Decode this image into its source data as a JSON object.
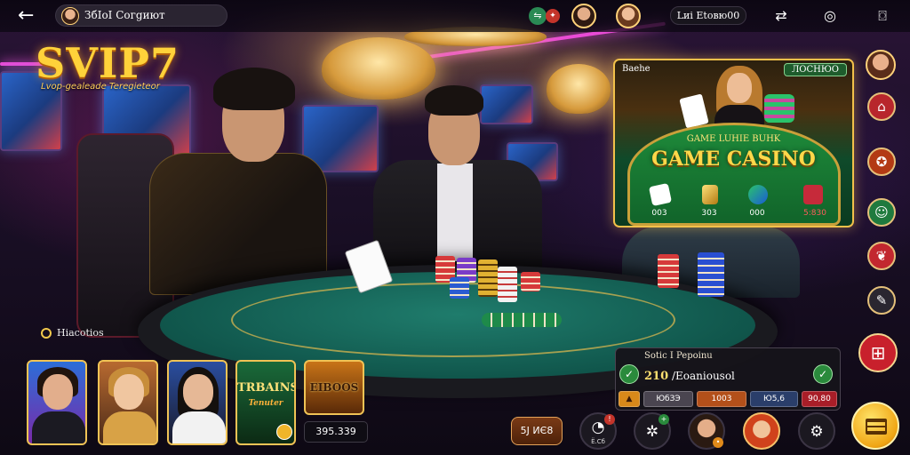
{
  "topbar": {
    "back_glyph": "←",
    "profile_name": "ЗбIоI Согgиют",
    "balance": "Lиі Еtовю00",
    "badge_green_glyph": "⇋",
    "badge_red_glyph": "✦",
    "icons": [
      "swap-icon",
      "target-icon",
      "camera-icon"
    ]
  },
  "logo": {
    "title": "SVIP7",
    "subtitle": "Lvop-gealeade Teregieteor"
  },
  "game_card": {
    "header_left": "Baehe",
    "header_right": "ЛОСНЮО",
    "subtitle": "GAME LUHIE BUHK",
    "title": "GAME CASINO",
    "stats": [
      "003",
      "303",
      "000",
      "5:830"
    ]
  },
  "left_label": "Hiacotios",
  "thumbs": [
    {
      "name": "player-1",
      "text": ""
    },
    {
      "name": "player-2",
      "text": ""
    },
    {
      "name": "player-3",
      "text": ""
    },
    {
      "name": "trebans",
      "text": "TRBAINS",
      "sub": "Tenuter"
    },
    {
      "name": "bingo",
      "text": "EIBOOS"
    }
  ],
  "thumb_amount": "395.339",
  "bottom": {
    "pill_label": "5J ИЄ8",
    "round_1_label": "Ё.Сб"
  },
  "bet_panel": {
    "title": "Sotic I Pepoinu",
    "amount": "210",
    "amount_suffix": "/Eoaniousol",
    "chips": [
      "ЮбЗЭ",
      "1003",
      "Ю5,6",
      "90,80"
    ]
  },
  "colors": {
    "gold": "#f2c14a",
    "felt": "#1f7c6c",
    "accent_pink": "#e94bd6"
  }
}
